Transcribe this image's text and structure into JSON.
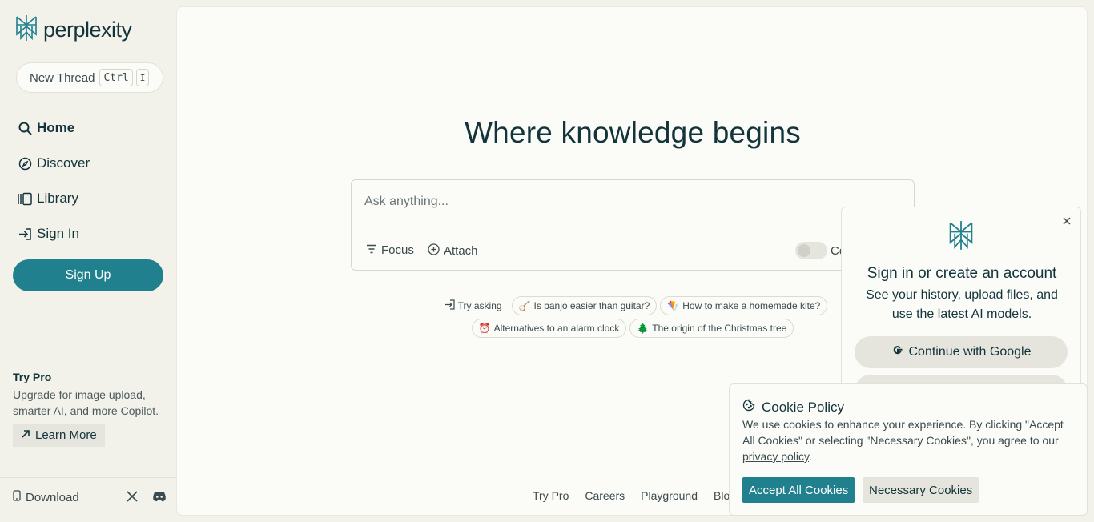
{
  "brand": {
    "name": "perplexity",
    "accent": "#20808d",
    "background": "#f2f1ea"
  },
  "sidebar": {
    "new_thread": {
      "label": "New Thread",
      "key1": "Ctrl",
      "key2": "I"
    },
    "nav": [
      {
        "label": "Home",
        "icon": "search-icon"
      },
      {
        "label": "Discover",
        "icon": "compass-icon"
      },
      {
        "label": "Library",
        "icon": "library-icon"
      },
      {
        "label": "Sign In",
        "icon": "sign-in-icon"
      }
    ],
    "signup_label": "Sign Up",
    "try_pro": {
      "title": "Try Pro",
      "description": "Upgrade for image upload, smarter AI, and more Copilot.",
      "button": "Learn More"
    },
    "footer": {
      "download": "Download",
      "social": [
        "x-icon",
        "discord-icon"
      ]
    }
  },
  "main": {
    "heading": "Where knowledge begins",
    "search": {
      "placeholder": "Ask anything...",
      "focus": "Focus",
      "attach": "Attach",
      "copilot_label": "Co"
    },
    "try_asking": "Try asking",
    "suggestions": [
      {
        "emoji": "🪕",
        "text": "Is banjo easier than guitar?"
      },
      {
        "emoji": "🪁",
        "text": "How to make a homemade kite?"
      },
      {
        "emoji": "⏰",
        "text": "Alternatives to an alarm clock"
      },
      {
        "emoji": "🌲",
        "text": "The origin of the Christmas tree"
      }
    ],
    "footer_links": [
      "Try Pro",
      "Careers",
      "Playground",
      "Blog"
    ]
  },
  "signin_popup": {
    "title": "Sign in or create an account",
    "subtitle": "See your history, upload files, and use the latest AI models.",
    "google_button": "Continue with Google"
  },
  "cookie": {
    "title": "Cookie Policy",
    "body_before": "We use cookies to enhance your experience. By clicking \"Accept All Cookies\" or selecting \"Necessary Cookies\", you agree to our ",
    "link": "privacy policy",
    "body_after": ".",
    "accept": "Accept All Cookies",
    "necessary": "Necessary Cookies"
  }
}
